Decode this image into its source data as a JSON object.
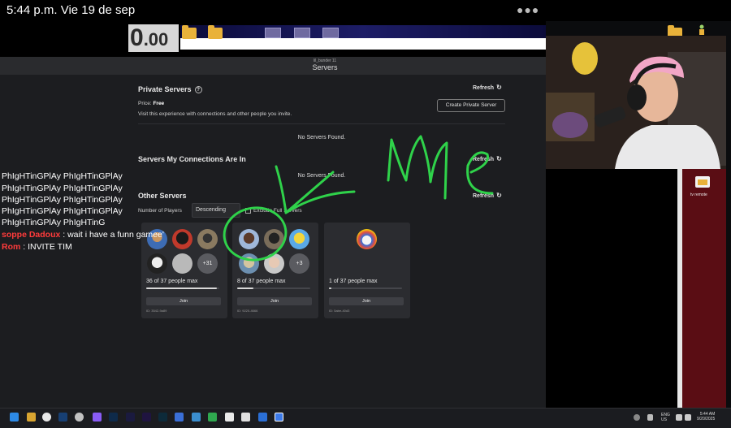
{
  "status_bar": {
    "time": "5:44 p.m.",
    "date": "Vie 19 de sep"
  },
  "stream_overlay": {
    "score_main": "0",
    "score_decimal": ".00"
  },
  "roblox": {
    "username": "lil_bunder 11",
    "page_title": "Servers",
    "private_servers": {
      "title": "Private Servers",
      "refresh_label": "Refresh",
      "price_label": "Price:",
      "price_value": "Free",
      "description": "Visit this experience with connections and other people you invite.",
      "create_button": "Create Private Server",
      "empty_message": "No Servers Found."
    },
    "connections_servers": {
      "title": "Servers My Connections Are In",
      "refresh_label": "Refresh",
      "empty_message": "No Servers Found."
    },
    "other_servers": {
      "title": "Other Servers",
      "refresh_label": "Refresh",
      "sort_label": "Number of Players",
      "sort_value": "Descending",
      "exclude_label": "Exclude Full Servers"
    },
    "servers": [
      {
        "count": "36 of 37 people max",
        "extra": "+31",
        "join": "Join",
        "id": "ID: 3542-9a89",
        "fill": 0.97
      },
      {
        "count": "8 of 37 people max",
        "extra": "+3",
        "join": "Join",
        "id": "ID: 9220-4666",
        "fill": 0.22
      },
      {
        "count": "1 of 37 people max",
        "extra": "",
        "join": "Join",
        "id": "ID: 5abe-40d3",
        "fill": 0.03
      }
    ]
  },
  "annotation": {
    "text": "Me"
  },
  "chat": {
    "spam": [
      "PhIgHTinGPlAy PhIgHTinGPlAy",
      "PhIgHTinGPlAy PhIgHTinGPlAy",
      "PhIgHTinGPlAy PhIgHTinGPlAy",
      "PhIgHTinGPlAy PhIgHTinGPlAy",
      "PhIgHTinGPlAy PhIgHTinG"
    ],
    "messages": [
      {
        "user": "soppe Dadoux",
        "text": ": wait i have a funn gamee'"
      },
      {
        "user": "Rom",
        "text": ": INVITE TIM"
      }
    ]
  },
  "side_panel": {
    "label": "tv remote"
  },
  "taskbar": {
    "lang": "ENG",
    "region": "US",
    "clock_time": "5:44 AM",
    "clock_date": "9/20/2025"
  },
  "colors": {
    "chat_name": "#ff3b3b",
    "annotation": "#2fd24a",
    "roblox_bg": "#1c1d20"
  }
}
